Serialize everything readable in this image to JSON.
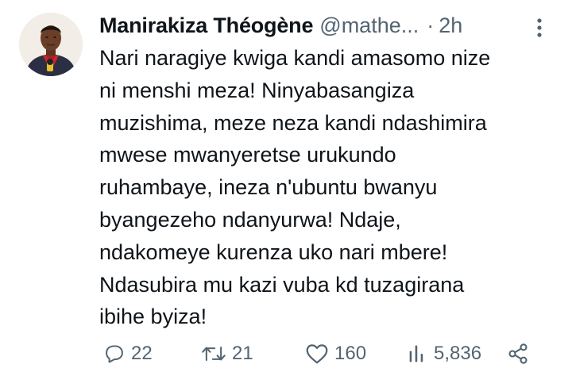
{
  "author": {
    "name": "Manirakiza Théogène",
    "handle": "@mathe...",
    "separator": "·",
    "time": "2h"
  },
  "tweet": {
    "lines": [
      "Nari naragiye kwiga kandi amasomo nize",
      "ni menshi meza! Ninyabasangiza",
      "muzishima, meze neza kandi ndashimira",
      "mwese mwanyeretse urukundo",
      "ruhambaye, ineza n'ubuntu bwanyu",
      "byangezeho ndanyurwa! Ndaje,",
      "ndakomeye kurenza uko nari mbere!",
      "Ndasubira mu kazi vuba kd tuzagirana",
      "ibihe byiza!"
    ]
  },
  "actions": {
    "replies": "22",
    "retweets": "21",
    "likes": "160",
    "views": "5,836"
  },
  "icons": {
    "more": "more-vertical-icon",
    "reply": "reply-bubble-icon",
    "retweet": "retweet-arrows-icon",
    "like": "heart-icon",
    "views": "views-bar-chart-icon",
    "share": "share-nodes-icon"
  },
  "colors": {
    "text": "#0f1419",
    "secondary": "#536471",
    "background": "#ffffff"
  }
}
